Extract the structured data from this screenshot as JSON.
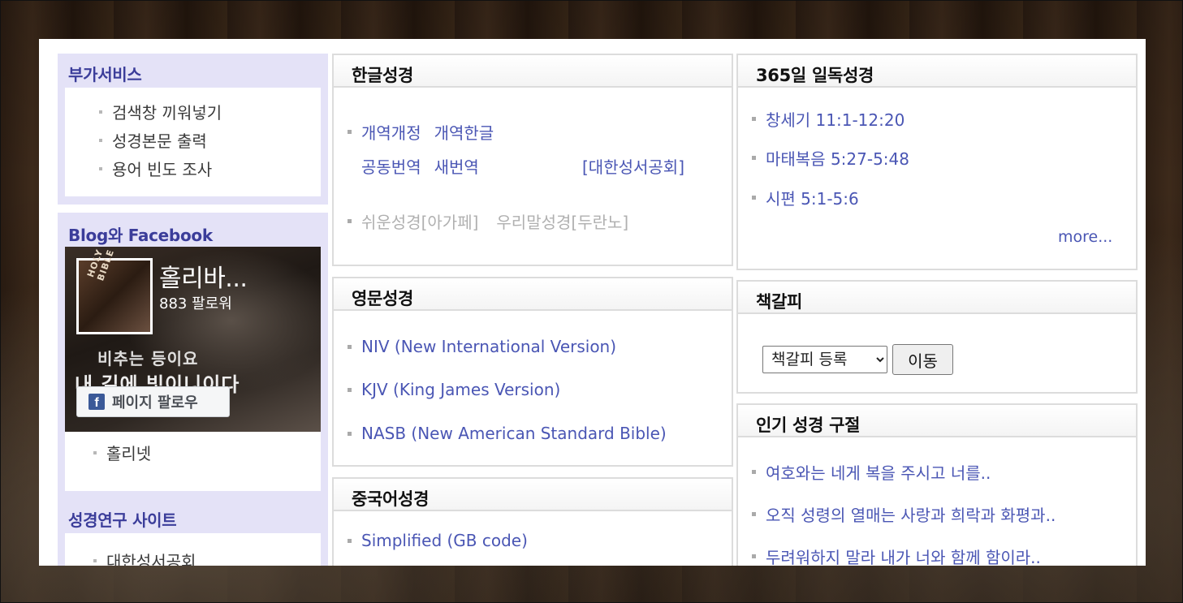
{
  "services": {
    "title": "부가서비스",
    "items": [
      "검색창 끼워넣기",
      "성경본문 출력",
      "용어 빈도 조사"
    ]
  },
  "blog": {
    "title": "Blog와 Facebook",
    "fb_page_name": "홀리바...",
    "fb_followers": "883 팔로워",
    "fb_overlay_line1": "비추는 등이요",
    "fb_overlay_line2": "내 길에 빛이니이다",
    "fb_thumb_text": "HOLY BIBLE",
    "fb_follow_button": "페이지 팔로우",
    "fb_logo": "f",
    "link": "홀리넷"
  },
  "research": {
    "title": "성경연구 사이트",
    "items": [
      "대한성서공회"
    ]
  },
  "korean_bible": {
    "title": "한글성경",
    "row1": [
      "개역개정",
      "개역한글"
    ],
    "row2": [
      "공동번역",
      "새번역"
    ],
    "publisher": "[대한성서공회]",
    "row3": [
      "쉬운성경[아가페]",
      "우리말성경[두란노]"
    ]
  },
  "english_bible": {
    "title": "영문성경",
    "items": [
      "NIV (New International Version)",
      "KJV (King James Version)",
      "NASB (New American Standard Bible)"
    ]
  },
  "chinese_bible": {
    "title": "중국어성경",
    "items": [
      "Simplified (GB code)"
    ]
  },
  "daily_reading": {
    "title": "365일 일독성경",
    "items": [
      "창세기 11:1-12:20",
      "마태복음 5:27-5:48",
      "시편 5:1-5:6"
    ],
    "more": "more..."
  },
  "bookmark": {
    "title": "책갈피",
    "select_value": "책갈피 등록",
    "go_label": "이동"
  },
  "popular_verses": {
    "title": "인기 성경 구절",
    "items": [
      "여호와는 네게 복을 주시고 너를..",
      "오직 성령의 열매는 사랑과 희락과 화평과..",
      "두려워하지 말라 내가 너와 함께 함이라.."
    ]
  }
}
